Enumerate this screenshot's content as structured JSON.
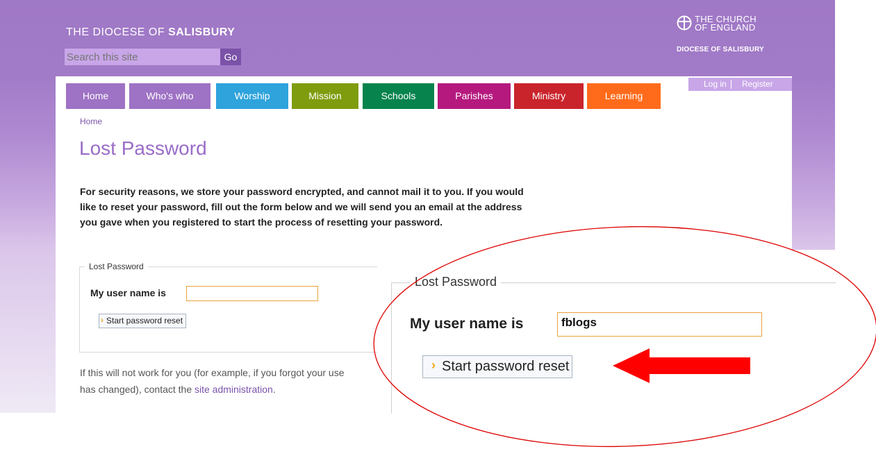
{
  "header": {
    "site_title_prefix": "THE DIOCESE OF ",
    "site_title_bold": "SALISBURY",
    "search": {
      "placeholder": "Search this site",
      "go_label": "Go"
    },
    "logo": {
      "line1": "THE CHURCH",
      "line2": "OF ENGLAND",
      "diocese": "DIOCESE OF SALISBURY"
    }
  },
  "nav": {
    "items": [
      {
        "label": "Home",
        "color": "#9e72c4"
      },
      {
        "label": "Who's who",
        "color": "#9e72c4"
      },
      {
        "label": "Worship",
        "color": "#2ea3dc"
      },
      {
        "label": "Mission",
        "color": "#7f9c0e"
      },
      {
        "label": "Schools",
        "color": "#07834d"
      },
      {
        "label": "Parishes",
        "color": "#b5197e"
      },
      {
        "label": "Ministry",
        "color": "#c9242b"
      },
      {
        "label": "Learning",
        "color": "#ff6b1a"
      }
    ]
  },
  "auth": {
    "login": "Log in",
    "register": "Register"
  },
  "breadcrumb": "Home",
  "page_title": "Lost Password",
  "intro": "For security reasons, we store your password encrypted, and cannot mail it to you. If you would like to reset your password, fill out the form below and we will send you an email at the address you gave when you registered to start the process of resetting your password.",
  "form": {
    "legend": "Lost Password",
    "username_label": "My user name is",
    "username_value": "",
    "submit_label": "Start password reset"
  },
  "zoom_form": {
    "legend": "Lost Password",
    "username_label": "My user name is",
    "username_value": "fblogs",
    "submit_label": "Start password reset"
  },
  "footer": {
    "text_before": "If this will not work for you (for example, if you forgot your use",
    "text_line2": "has changed), contact the ",
    "link": "site administration",
    "text_after": "."
  },
  "annotation": {
    "arrow_color": "#ff0000",
    "ellipse_color": "#dd0000"
  }
}
